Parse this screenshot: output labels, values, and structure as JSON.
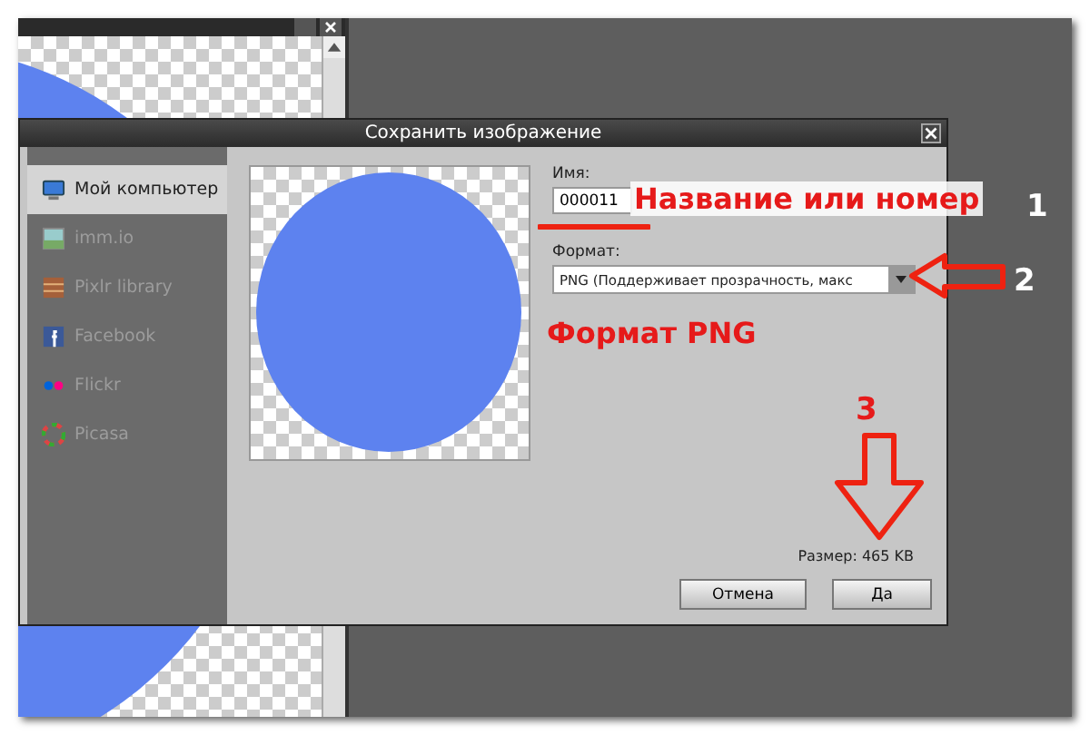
{
  "dialog": {
    "title": "Сохранить изображение",
    "sidebar": [
      {
        "kind": "computer",
        "label": "Мой компьютер",
        "selected": true
      },
      {
        "kind": "image",
        "label": "imm.io",
        "selected": false
      },
      {
        "kind": "library",
        "label": "Pixlr library",
        "selected": false
      },
      {
        "kind": "facebook",
        "label": "Facebook",
        "selected": false
      },
      {
        "kind": "flickr",
        "label": "Flickr",
        "selected": false
      },
      {
        "kind": "picasa",
        "label": "Picasa",
        "selected": false
      }
    ],
    "name_label": "Имя:",
    "name_value": "000011",
    "format_label": "Формат:",
    "format_value": "PNG (Поддерживает прозрачность, макс",
    "size": "Размер: 465 KB",
    "buttons": [
      "Отмена",
      "Да"
    ]
  },
  "annotations": {
    "name_note": "Название или номер",
    "format_note": "Формат PNG",
    "steps": [
      "1",
      "2",
      "3"
    ]
  }
}
